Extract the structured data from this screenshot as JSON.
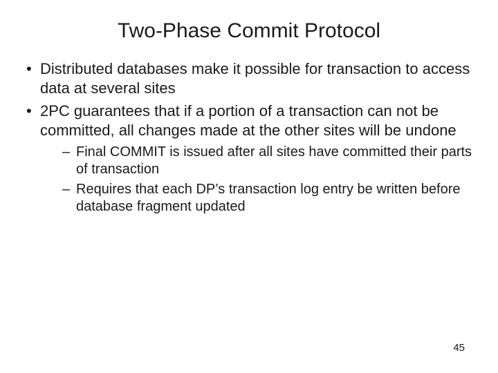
{
  "title": "Two-Phase Commit Protocol",
  "bullets": [
    {
      "text": "Distributed databases make it possible for transaction to access data at several sites"
    },
    {
      "text": "2PC guarantees that if a portion of a transaction can not be committed, all changes made at the other sites will be undone"
    }
  ],
  "subbullets": [
    {
      "text": "Final COMMIT is issued after all sites have committed their parts of transaction"
    },
    {
      "text": "Requires that each DP’s transaction log entry be written before database fragment updated"
    }
  ],
  "page_number": "45"
}
